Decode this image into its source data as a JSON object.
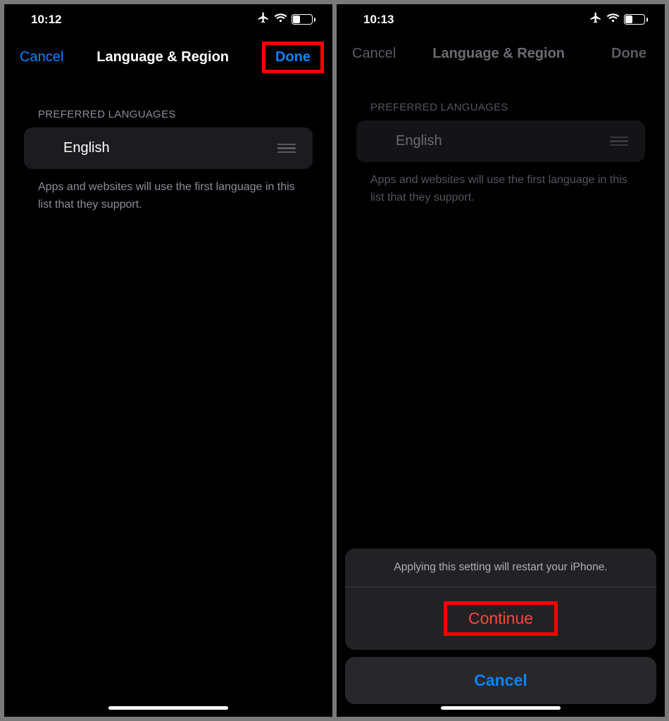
{
  "left": {
    "time": "10:12",
    "battery": "37",
    "nav": {
      "cancel": "Cancel",
      "title": "Language & Region",
      "done": "Done"
    },
    "section_header": "PREFERRED LANGUAGES",
    "row_label": "English",
    "footer": "Apps and websites will use the first language in this list that they support."
  },
  "right": {
    "time": "10:13",
    "battery": "37",
    "nav": {
      "cancel": "Cancel",
      "title": "Language & Region",
      "done": "Done"
    },
    "section_header": "PREFERRED LANGUAGES",
    "row_label": "English",
    "footer": "Apps and websites will use the first language in this list that they support.",
    "sheet": {
      "message": "Applying this setting will restart your iPhone.",
      "continue": "Continue",
      "cancel": "Cancel"
    }
  }
}
